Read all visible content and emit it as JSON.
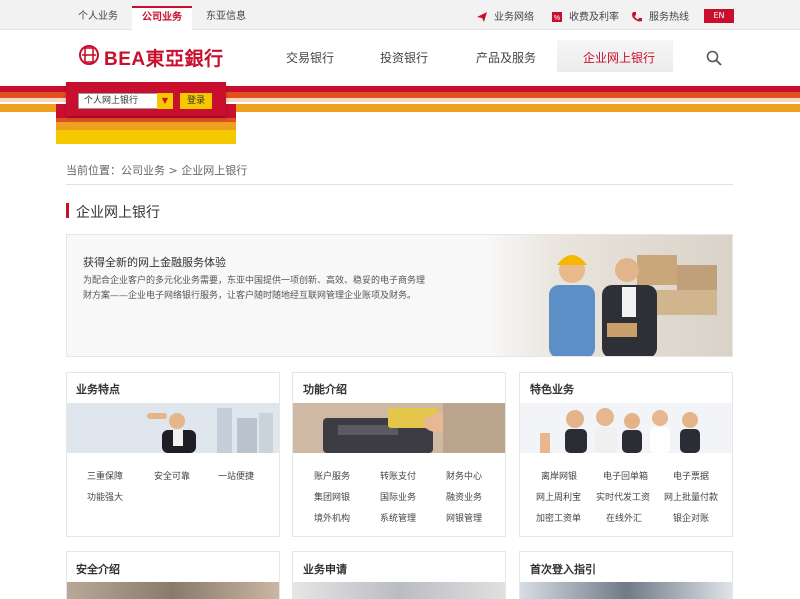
{
  "topbar": {
    "tabs": [
      "个人业务",
      "公司业务",
      "东亚信息"
    ],
    "links": [
      "业务网络",
      "收费及利率",
      "服务热线"
    ],
    "lang": "EN"
  },
  "header": {
    "logo_text": "BEA東亞銀行",
    "nav": [
      "交易银行",
      "投资银行",
      "产品及服务",
      "企业网上银行"
    ]
  },
  "login": {
    "select_value": "个人网上银行",
    "button": "登录"
  },
  "breadcrumb": "当前位置：公司业务 > 企业网上银行",
  "page_title": "企业网上银行",
  "banner": {
    "title": "获得全新的网上金融服务体验",
    "desc": "为配合企业客户的多元化业务需要，东亚中国提供一项创新、高效、稳妥的电子商务理财方案——企业电子网络银行服务，让客户随时随地经互联网管理企业账项及财务。"
  },
  "cards": [
    {
      "title": "业务特点",
      "links": [
        "三重保障",
        "安全可靠",
        "一站便捷",
        "功能强大"
      ]
    },
    {
      "title": "功能介绍",
      "links": [
        "账户服务",
        "转账支付",
        "财务中心",
        "集团网银",
        "国际业务",
        "融资业务",
        "境外机构",
        "系统管理",
        "网银管理"
      ]
    },
    {
      "title": "特色业务",
      "links": [
        "离岸网银",
        "电子回单箱",
        "电子票据",
        "网上周利宝",
        "实时代发工资",
        "网上批量付款",
        "加密工资单",
        "在线外汇",
        "银企对账"
      ]
    }
  ],
  "cards2": [
    {
      "title": "安全介绍"
    },
    {
      "title": "业务申请"
    },
    {
      "title": "首次登入指引"
    }
  ],
  "colors": {
    "brand_red": "#c8102e",
    "accent_yellow": "#f5c800",
    "stripe_orange": "#f0a020"
  }
}
